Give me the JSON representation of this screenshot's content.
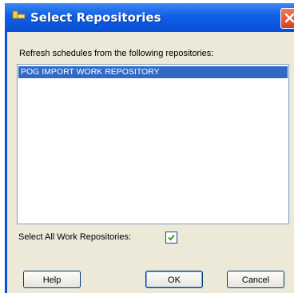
{
  "window": {
    "title": "Select Repositories",
    "close_icon": "close-icon"
  },
  "prompt": "Refresh schedules from the following repositories:",
  "repositories": [
    {
      "label": "POG IMPORT WORK REPOSITORY",
      "selected": true
    }
  ],
  "select_all": {
    "label": "Select All Work Repositories:",
    "checked": true
  },
  "buttons": {
    "help": "Help",
    "ok": "OK",
    "cancel": "Cancel"
  },
  "colors": {
    "titlebar": "#0a51d8",
    "dialog_bg": "#ece9d8",
    "selection": "#316ac5",
    "close": "#d9401c"
  }
}
